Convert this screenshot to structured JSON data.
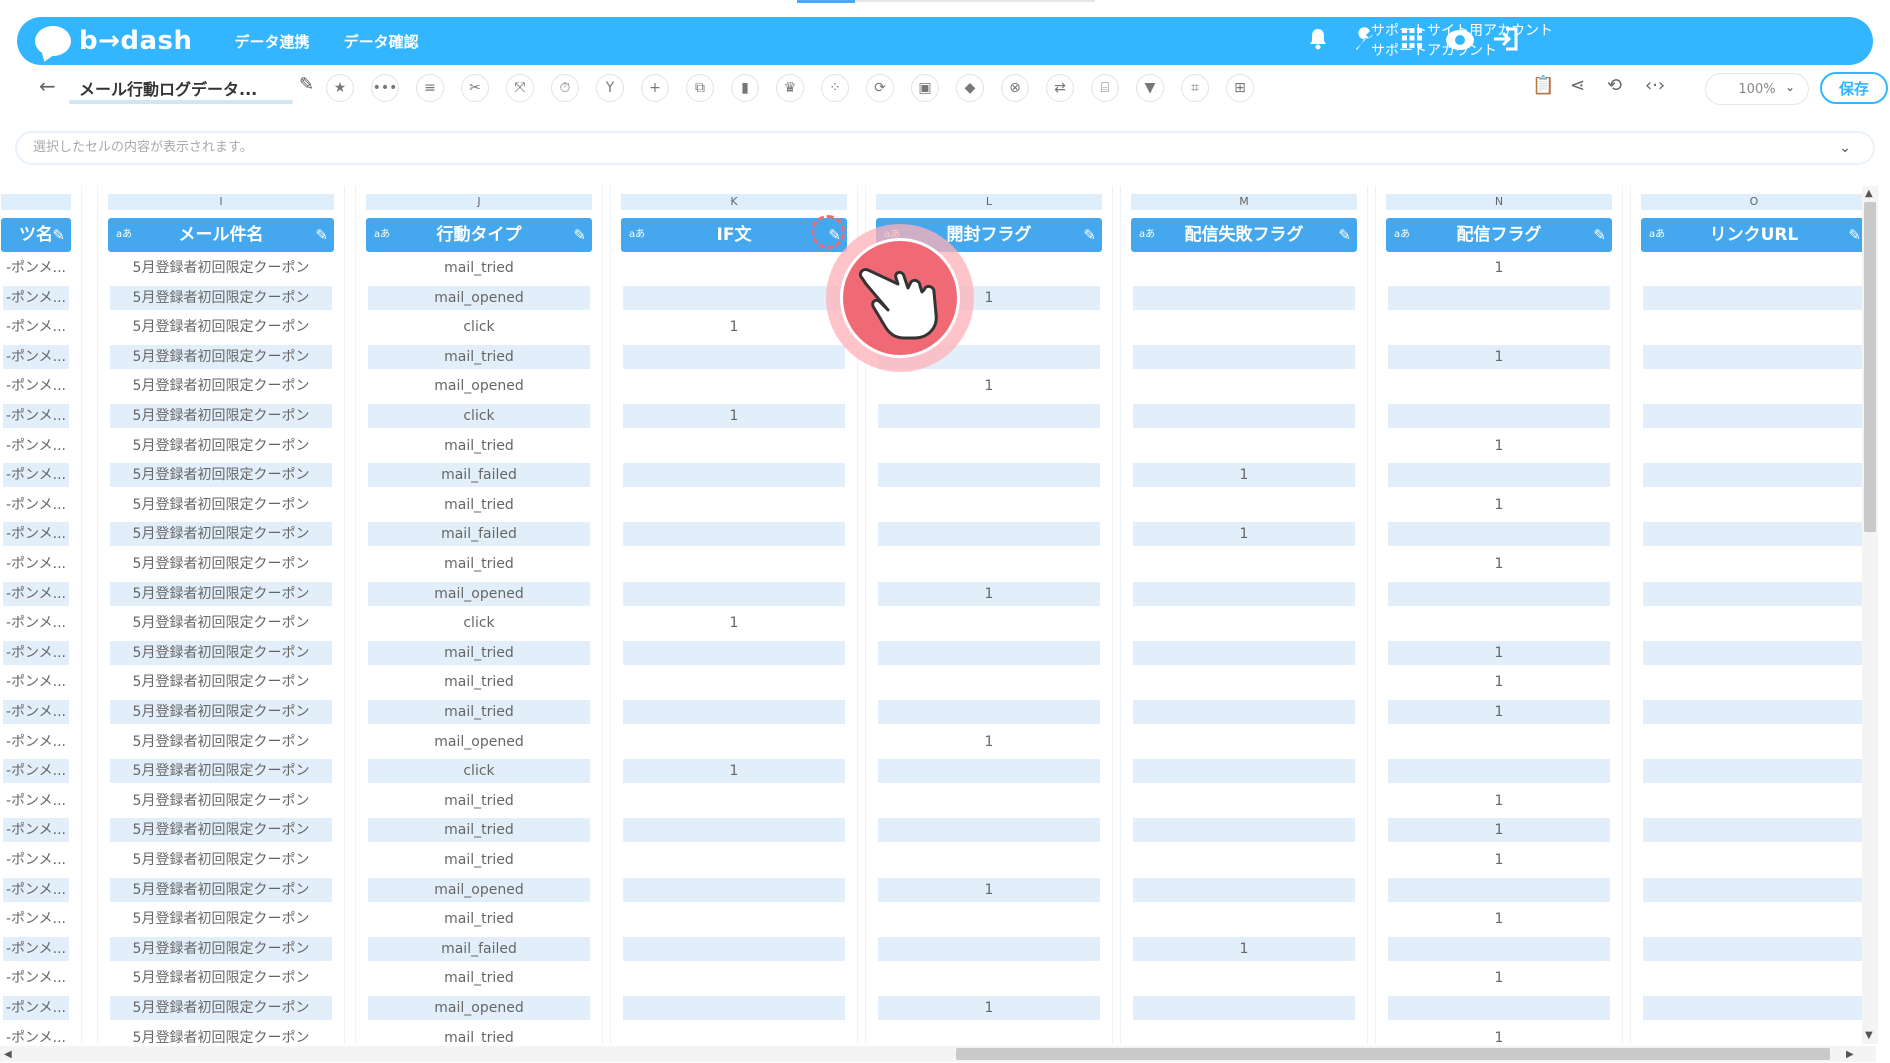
{
  "header": {
    "logo_text": "b→dash",
    "nav": [
      "データ連携",
      "データ確認"
    ],
    "account_line1": "サポートサイト用アカウント",
    "account_line2": "サポートアカウント",
    "icons": [
      "bell-icon",
      "wrench-icon",
      "grid-icon",
      "cloud-icon",
      "logout-icon"
    ]
  },
  "toolbar": {
    "back": "←",
    "doc_title": "メール行動ログデータ...",
    "zoom": "100%",
    "save_label": "保存",
    "tools": [
      "star-icon",
      "more-icon",
      "list-icon",
      "scissors-icon",
      "expand-icon",
      "timer-icon",
      "merge-icon",
      "plus-icon",
      "copy-icon",
      "trash-icon",
      "crown-icon",
      "scatter-icon",
      "refresh-icon",
      "lock-icon",
      "drop-icon",
      "cancel-icon",
      "shuffle-icon",
      "bracket-icon",
      "filter-icon",
      "kanji-icon",
      "table-icon"
    ],
    "right_icons": [
      "clipboard-icon",
      "share-icon",
      "rotate-icon",
      "code-icon"
    ]
  },
  "cellbar": {
    "placeholder": "選択したセルの内容が表示されます。"
  },
  "grid": {
    "type_badge": "aあ",
    "columns": [
      {
        "letter": "",
        "name": "ツ名"
      },
      {
        "letter": "I",
        "name": "メール件名"
      },
      {
        "letter": "J",
        "name": "行動タイプ"
      },
      {
        "letter": "K",
        "name": "IF文"
      },
      {
        "letter": "L",
        "name": "開封フラグ"
      },
      {
        "letter": "M",
        "name": "配信失敗フラグ"
      },
      {
        "letter": "N",
        "name": "配信フラグ"
      },
      {
        "letter": "O",
        "name": "リンクURL"
      }
    ],
    "rows": [
      [
        "-ポンメ...",
        "5月登録者初回限定クーポン",
        "mail_tried",
        "",
        "",
        "",
        "1",
        ""
      ],
      [
        "-ポンメ...",
        "5月登録者初回限定クーポン",
        "mail_opened",
        "",
        "1",
        "",
        "",
        ""
      ],
      [
        "-ポンメ...",
        "5月登録者初回限定クーポン",
        "click",
        "1",
        "",
        "",
        "",
        ""
      ],
      [
        "-ポンメ...",
        "5月登録者初回限定クーポン",
        "mail_tried",
        "",
        "",
        "",
        "1",
        ""
      ],
      [
        "-ポンメ...",
        "5月登録者初回限定クーポン",
        "mail_opened",
        "",
        "1",
        "",
        "",
        ""
      ],
      [
        "-ポンメ...",
        "5月登録者初回限定クーポン",
        "click",
        "1",
        "",
        "",
        "",
        ""
      ],
      [
        "-ポンメ...",
        "5月登録者初回限定クーポン",
        "mail_tried",
        "",
        "",
        "",
        "1",
        ""
      ],
      [
        "-ポンメ...",
        "5月登録者初回限定クーポン",
        "mail_failed",
        "",
        "",
        "1",
        "",
        ""
      ],
      [
        "-ポンメ...",
        "5月登録者初回限定クーポン",
        "mail_tried",
        "",
        "",
        "",
        "1",
        ""
      ],
      [
        "-ポンメ...",
        "5月登録者初回限定クーポン",
        "mail_failed",
        "",
        "",
        "1",
        "",
        ""
      ],
      [
        "-ポンメ...",
        "5月登録者初回限定クーポン",
        "mail_tried",
        "",
        "",
        "",
        "1",
        ""
      ],
      [
        "-ポンメ...",
        "5月登録者初回限定クーポン",
        "mail_opened",
        "",
        "1",
        "",
        "",
        ""
      ],
      [
        "-ポンメ...",
        "5月登録者初回限定クーポン",
        "click",
        "1",
        "",
        "",
        "",
        ""
      ],
      [
        "-ポンメ...",
        "5月登録者初回限定クーポン",
        "mail_tried",
        "",
        "",
        "",
        "1",
        ""
      ],
      [
        "-ポンメ...",
        "5月登録者初回限定クーポン",
        "mail_tried",
        "",
        "",
        "",
        "1",
        ""
      ],
      [
        "-ポンメ...",
        "5月登録者初回限定クーポン",
        "mail_tried",
        "",
        "",
        "",
        "1",
        ""
      ],
      [
        "-ポンメ...",
        "5月登録者初回限定クーポン",
        "mail_opened",
        "",
        "1",
        "",
        "",
        ""
      ],
      [
        "-ポンメ...",
        "5月登録者初回限定クーポン",
        "click",
        "1",
        "",
        "",
        "",
        ""
      ],
      [
        "-ポンメ...",
        "5月登録者初回限定クーポン",
        "mail_tried",
        "",
        "",
        "",
        "1",
        ""
      ],
      [
        "-ポンメ...",
        "5月登録者初回限定クーポン",
        "mail_tried",
        "",
        "",
        "",
        "1",
        ""
      ],
      [
        "-ポンメ...",
        "5月登録者初回限定クーポン",
        "mail_tried",
        "",
        "",
        "",
        "1",
        ""
      ],
      [
        "-ポンメ...",
        "5月登録者初回限定クーポン",
        "mail_opened",
        "",
        "1",
        "",
        "",
        ""
      ],
      [
        "-ポンメ...",
        "5月登録者初回限定クーポン",
        "mail_tried",
        "",
        "",
        "",
        "1",
        ""
      ],
      [
        "-ポンメ...",
        "5月登録者初回限定クーポン",
        "mail_failed",
        "",
        "",
        "1",
        "",
        ""
      ],
      [
        "-ポンメ...",
        "5月登録者初回限定クーポン",
        "mail_tried",
        "",
        "",
        "",
        "1",
        ""
      ],
      [
        "-ポンメ...",
        "5月登録者初回限定クーポン",
        "mail_opened",
        "",
        "1",
        "",
        "",
        ""
      ],
      [
        "-ポンメ...",
        "5月登録者初回限定クーポン",
        "mail_tried",
        "",
        "",
        "",
        "1",
        ""
      ]
    ]
  },
  "colors": {
    "header_bg": "#33b6ff",
    "col_header_bg": "#45a8ee",
    "row_shade": "#e2effa",
    "tap_marker": "#f06a76"
  }
}
